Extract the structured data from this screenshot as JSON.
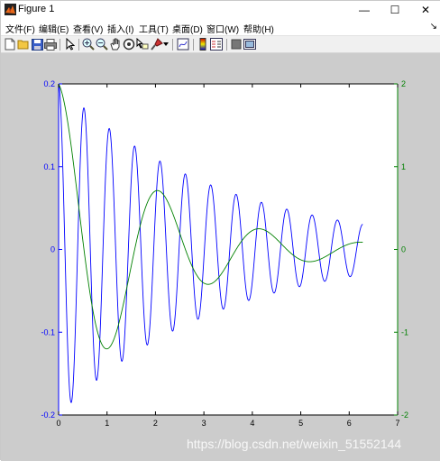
{
  "window": {
    "title": "Figure 1",
    "minimize": "—",
    "maximize": "☐",
    "close": "✕"
  },
  "menu": {
    "items": [
      "文件(F)",
      "编辑(E)",
      "查看(V)",
      "插入(I)",
      "工具(T)",
      "桌面(D)",
      "窗口(W)",
      "帮助(H)"
    ],
    "overflow": "↘"
  },
  "toolbar": {
    "icons": [
      "new-figure-icon",
      "open-file-icon",
      "save-icon",
      "print-icon",
      "edit-plot-arrow-icon",
      "zoom-in-icon",
      "zoom-out-icon",
      "pan-hand-icon",
      "rotate-3d-icon",
      "data-cursor-icon",
      "brush-icon",
      "brush-dropdown-icon",
      "link-plot-icon",
      "insert-colorbar-icon",
      "insert-legend-icon",
      "hide-plot-tools-icon",
      "show-plot-tools-icon"
    ]
  },
  "chart_data": {
    "type": "line",
    "title": "",
    "xlabel": "",
    "ylabel": "",
    "xlim": [
      0,
      7
    ],
    "xticks": [
      "0",
      "1",
      "2",
      "3",
      "4",
      "5",
      "6",
      "7"
    ],
    "y1lim": [
      -0.2,
      0.2
    ],
    "y1ticks": [
      "0.2",
      "0.1",
      "0",
      "-0.1",
      "-0.2"
    ],
    "y2lim": [
      -2,
      2
    ],
    "y2ticks": [
      "2",
      "1",
      "0",
      "-1",
      "-2"
    ],
    "grid": false,
    "series": [
      {
        "axis": "left",
        "color": "#0000ff",
        "model": "0.2*exp(-0.3t)*cos(12t)",
        "x_range": [
          0,
          6.28
        ],
        "x": [
          0,
          0.25,
          0.5,
          0.75,
          1.0,
          1.5,
          2.0,
          3.0,
          4.0,
          5.0,
          6.0
        ],
        "y_envelope": [
          0.2,
          0.186,
          0.172,
          0.16,
          0.148,
          0.128,
          0.11,
          0.081,
          0.06,
          0.045,
          0.033
        ]
      },
      {
        "axis": "right",
        "color": "#008000",
        "model": "2*exp(-0.5t)*cos(3t)",
        "x_range": [
          0,
          6.28
        ],
        "x": [
          0,
          1.0,
          2.0,
          3.0,
          4.0,
          5.0,
          6.0
        ],
        "y": [
          2.0,
          -1.2,
          0.71,
          -0.2,
          0.23,
          -0.13,
          0.03
        ]
      }
    ]
  },
  "watermark": "https://blog.csdn.net/weixin_51552144",
  "colors": {
    "figure_bg": "#cccccc",
    "axes_bg": "#ffffff",
    "left_axis": "#0000ff",
    "right_axis": "#008000"
  }
}
